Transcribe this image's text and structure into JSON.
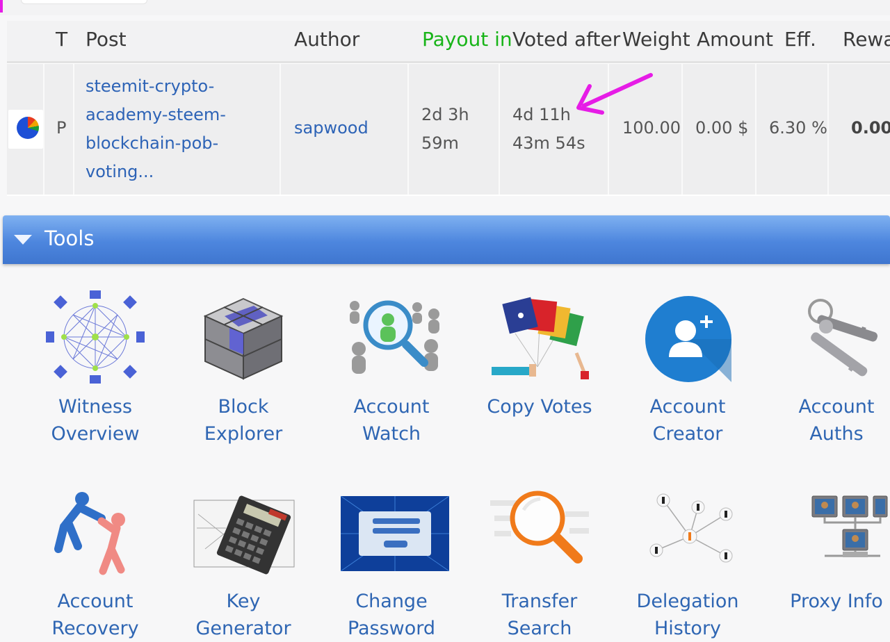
{
  "table": {
    "headers": [
      "T",
      "Post",
      "Author",
      "Payout in",
      "Voted after",
      "Weight",
      "Amount",
      "Eff.",
      "Rewa"
    ],
    "row": {
      "type": "P",
      "post_lines": [
        "steemit-crypto-",
        "academy-steem-",
        "blockchain-pob-",
        "voting..."
      ],
      "author": "sapwood",
      "payout_in_lines": [
        "2d 3h",
        "59m"
      ],
      "voted_after_lines": [
        "4d 11h",
        "43m 54s"
      ],
      "weight": "100.00",
      "amount": "0.00 $",
      "eff": "6.30 %",
      "reward": "0.00"
    }
  },
  "tools": {
    "title": "Tools",
    "items": [
      {
        "icon": "witness-network-icon",
        "lines": [
          "Witness",
          "Overview"
        ]
      },
      {
        "icon": "cube-icon",
        "lines": [
          "Block",
          "Explorer"
        ]
      },
      {
        "icon": "magnifier-people-icon",
        "lines": [
          "Account",
          "Watch"
        ]
      },
      {
        "icon": "colored-flags-icon",
        "lines": [
          "Copy Votes",
          ""
        ]
      },
      {
        "icon": "add-user-icon",
        "lines": [
          "Account",
          "Creator"
        ]
      },
      {
        "icon": "keys-icon",
        "lines": [
          "Account",
          "Auths"
        ]
      },
      {
        "icon": "helping-hand-icon",
        "lines": [
          "Account",
          "Recovery"
        ]
      },
      {
        "icon": "calculator-icon",
        "lines": [
          "Key",
          "Generator"
        ]
      },
      {
        "icon": "login-screen-icon",
        "lines": [
          "Change",
          "Password"
        ]
      },
      {
        "icon": "search-icon",
        "lines": [
          "Transfer",
          "Search"
        ]
      },
      {
        "icon": "delegation-network-icon",
        "lines": [
          "Delegation",
          "History"
        ]
      },
      {
        "icon": "proxy-monitors-icon",
        "lines": [
          "Proxy Info",
          ""
        ]
      }
    ]
  },
  "colors": {
    "payout_header": "#18b418",
    "link": "#2d63b6",
    "tools_bar": "#4d86de",
    "annotation_arrow": "#e61ce6"
  }
}
